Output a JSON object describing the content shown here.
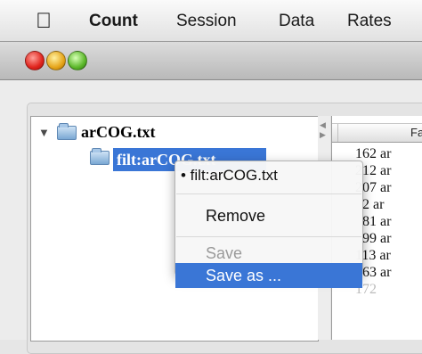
{
  "menubar": {
    "apple_icon": "apple-logo-icon",
    "items": [
      "Count",
      "Session",
      "Data",
      "Rates"
    ]
  },
  "window": {
    "traffic_lights": {
      "close_color": "#e0241d",
      "minimize_color": "#e6a51a",
      "zoom_color": "#5cb82a"
    }
  },
  "tree": {
    "root": {
      "label": "arCOG.txt",
      "expanded": true
    },
    "child": {
      "label": "filt:arCOG.txt",
      "selected": true
    }
  },
  "table": {
    "header": "Fa",
    "rows": [
      "162 ar",
      "212 ar",
      "207 ar",
      "2 ar",
      "81 ar",
      "99 ar",
      "113 ar",
      "163 ar",
      "172"
    ]
  },
  "context_menu": {
    "header": "• filt:arCOG.txt",
    "items": [
      {
        "label": "Remove",
        "enabled": true
      },
      {
        "label": "Save",
        "enabled": false
      },
      {
        "label": "Save as ...",
        "enabled": true,
        "highlighted": true
      }
    ]
  },
  "colors": {
    "selection": "#3a76d6"
  }
}
